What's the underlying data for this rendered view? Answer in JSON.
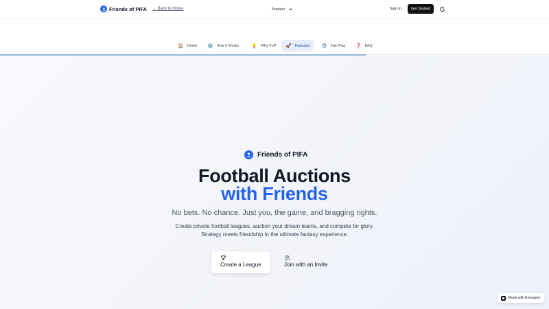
{
  "header": {
    "brand": "Friends of PIFA",
    "back_link": "← Back to Home",
    "product_menu": "Product",
    "sign_in": "Sign In",
    "get_started": "Get Started",
    "icons": {
      "logo": "users-icon",
      "chevron": "chevron-down-icon",
      "theme": "moon-icon"
    }
  },
  "subnav": {
    "items": [
      {
        "emoji": "🏠",
        "label": "Home"
      },
      {
        "emoji": "⚙️",
        "label": "How it Works"
      },
      {
        "emoji": "💡",
        "label": "Why FoP"
      },
      {
        "emoji": "🚀",
        "label": "Features"
      },
      {
        "emoji": "🛡️",
        "label": "Fair Play"
      },
      {
        "emoji": "❓",
        "label": "FAQ"
      }
    ],
    "active": "Features"
  },
  "hero": {
    "brand": "Friends of PIFA",
    "headline_line1": "Football Auctions",
    "headline_line2": "with Friends",
    "tagline": "No bets. No chance. Just you, the game, and bragging rights.",
    "description": "Create private football leagues, auction your dream teams, and compete for glory. Strategy meets friendship in the ultimate fantasy experience.",
    "cta_primary": "Create a League",
    "cta_secondary": "Join with an Invite",
    "icons": {
      "primary": "trophy-icon",
      "secondary": "users-icon"
    }
  },
  "badge": {
    "label": "Made with Emergent"
  },
  "colors": {
    "accent": "#2563eb",
    "dark_button": "#111111",
    "active_tab_bg": "#e5edfb",
    "progress": "#93b6de"
  }
}
